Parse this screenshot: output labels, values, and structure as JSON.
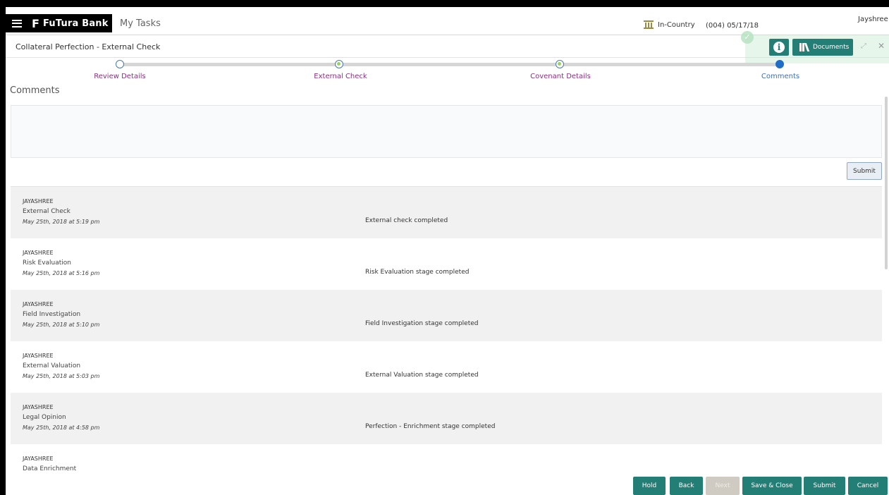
{
  "header": {
    "brand": "FuTura Bank",
    "logo_glyph": "F",
    "app_title": "My Tasks",
    "country": "In-Country",
    "branch_date": "(004)  05/17/18",
    "user": "Jayshree"
  },
  "title_bar": {
    "title": "Collateral Perfection - External Check",
    "documents_label": "Documents",
    "icons": [
      "info-icon",
      "books-icon",
      "expand-icon",
      "close-icon"
    ]
  },
  "stepper": {
    "steps": [
      {
        "label": "Review Details",
        "state": "visited"
      },
      {
        "label": "External Check",
        "state": "done"
      },
      {
        "label": "Covenant Details",
        "state": "done"
      },
      {
        "label": "Comments",
        "state": "active"
      }
    ]
  },
  "comments": {
    "section_title": "Comments",
    "input_value": "",
    "submit_label": "Submit",
    "entries": [
      {
        "user": "JAYASHREE",
        "stage": "External Check",
        "time": "May 25th, 2018 at 5:19 pm",
        "text": "External check completed"
      },
      {
        "user": "JAYASHREE",
        "stage": "Risk Evaluation",
        "time": "May 25th, 2018 at 5:16 pm",
        "text": "Risk Evaluation stage completed"
      },
      {
        "user": "JAYASHREE",
        "stage": "Field Investigation",
        "time": "May 25th, 2018 at 5:10 pm",
        "text": "Field Investigation stage completed"
      },
      {
        "user": "JAYASHREE",
        "stage": "External Valuation",
        "time": "May 25th, 2018 at 5:03 pm",
        "text": "External Valuation stage completed"
      },
      {
        "user": "JAYASHREE",
        "stage": "Legal Opinion",
        "time": "May 25th, 2018 at 4:58 pm",
        "text": "Perfection - Enrichment stage completed"
      },
      {
        "user": "JAYASHREE",
        "stage": "Data Enrichment",
        "time": "",
        "text": ""
      }
    ]
  },
  "footer": {
    "hold": "Hold",
    "back": "Back",
    "next": "Next",
    "save_close": "Save & Close",
    "submit": "Submit",
    "cancel": "Cancel"
  },
  "colors": {
    "accent": "#237f76",
    "step_label": "#8b2f82",
    "active_step": "#1e6dc8",
    "disabled_button": "#cfcbc3"
  }
}
